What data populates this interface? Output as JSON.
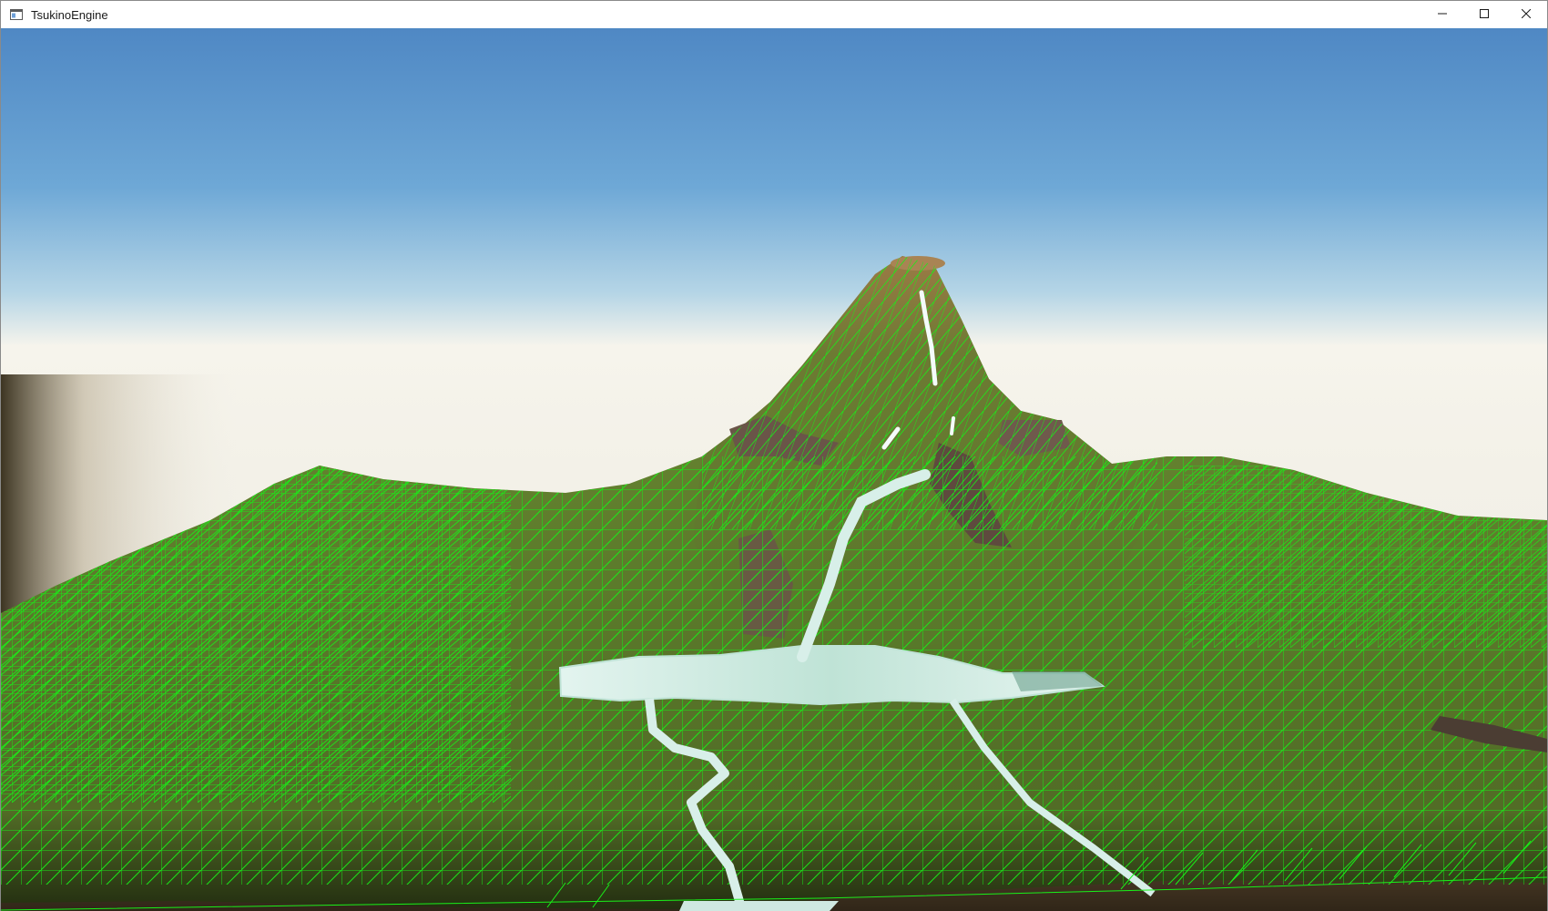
{
  "window": {
    "title": "TsukinoEngine",
    "icon": "app-window-icon",
    "controls": {
      "minimize": "minimize-icon",
      "maximize": "maximize-icon",
      "close": "close-icon"
    }
  },
  "scene": {
    "sky_top_color": "#4f88c4",
    "sky_horizon_color": "#f6f4ec",
    "terrain_color": "#5e7a2e",
    "wireframe_color": "#19f019",
    "water_color": "#d8efe9",
    "ground_color": "#6b5436",
    "rock_color": "#6a5548"
  }
}
